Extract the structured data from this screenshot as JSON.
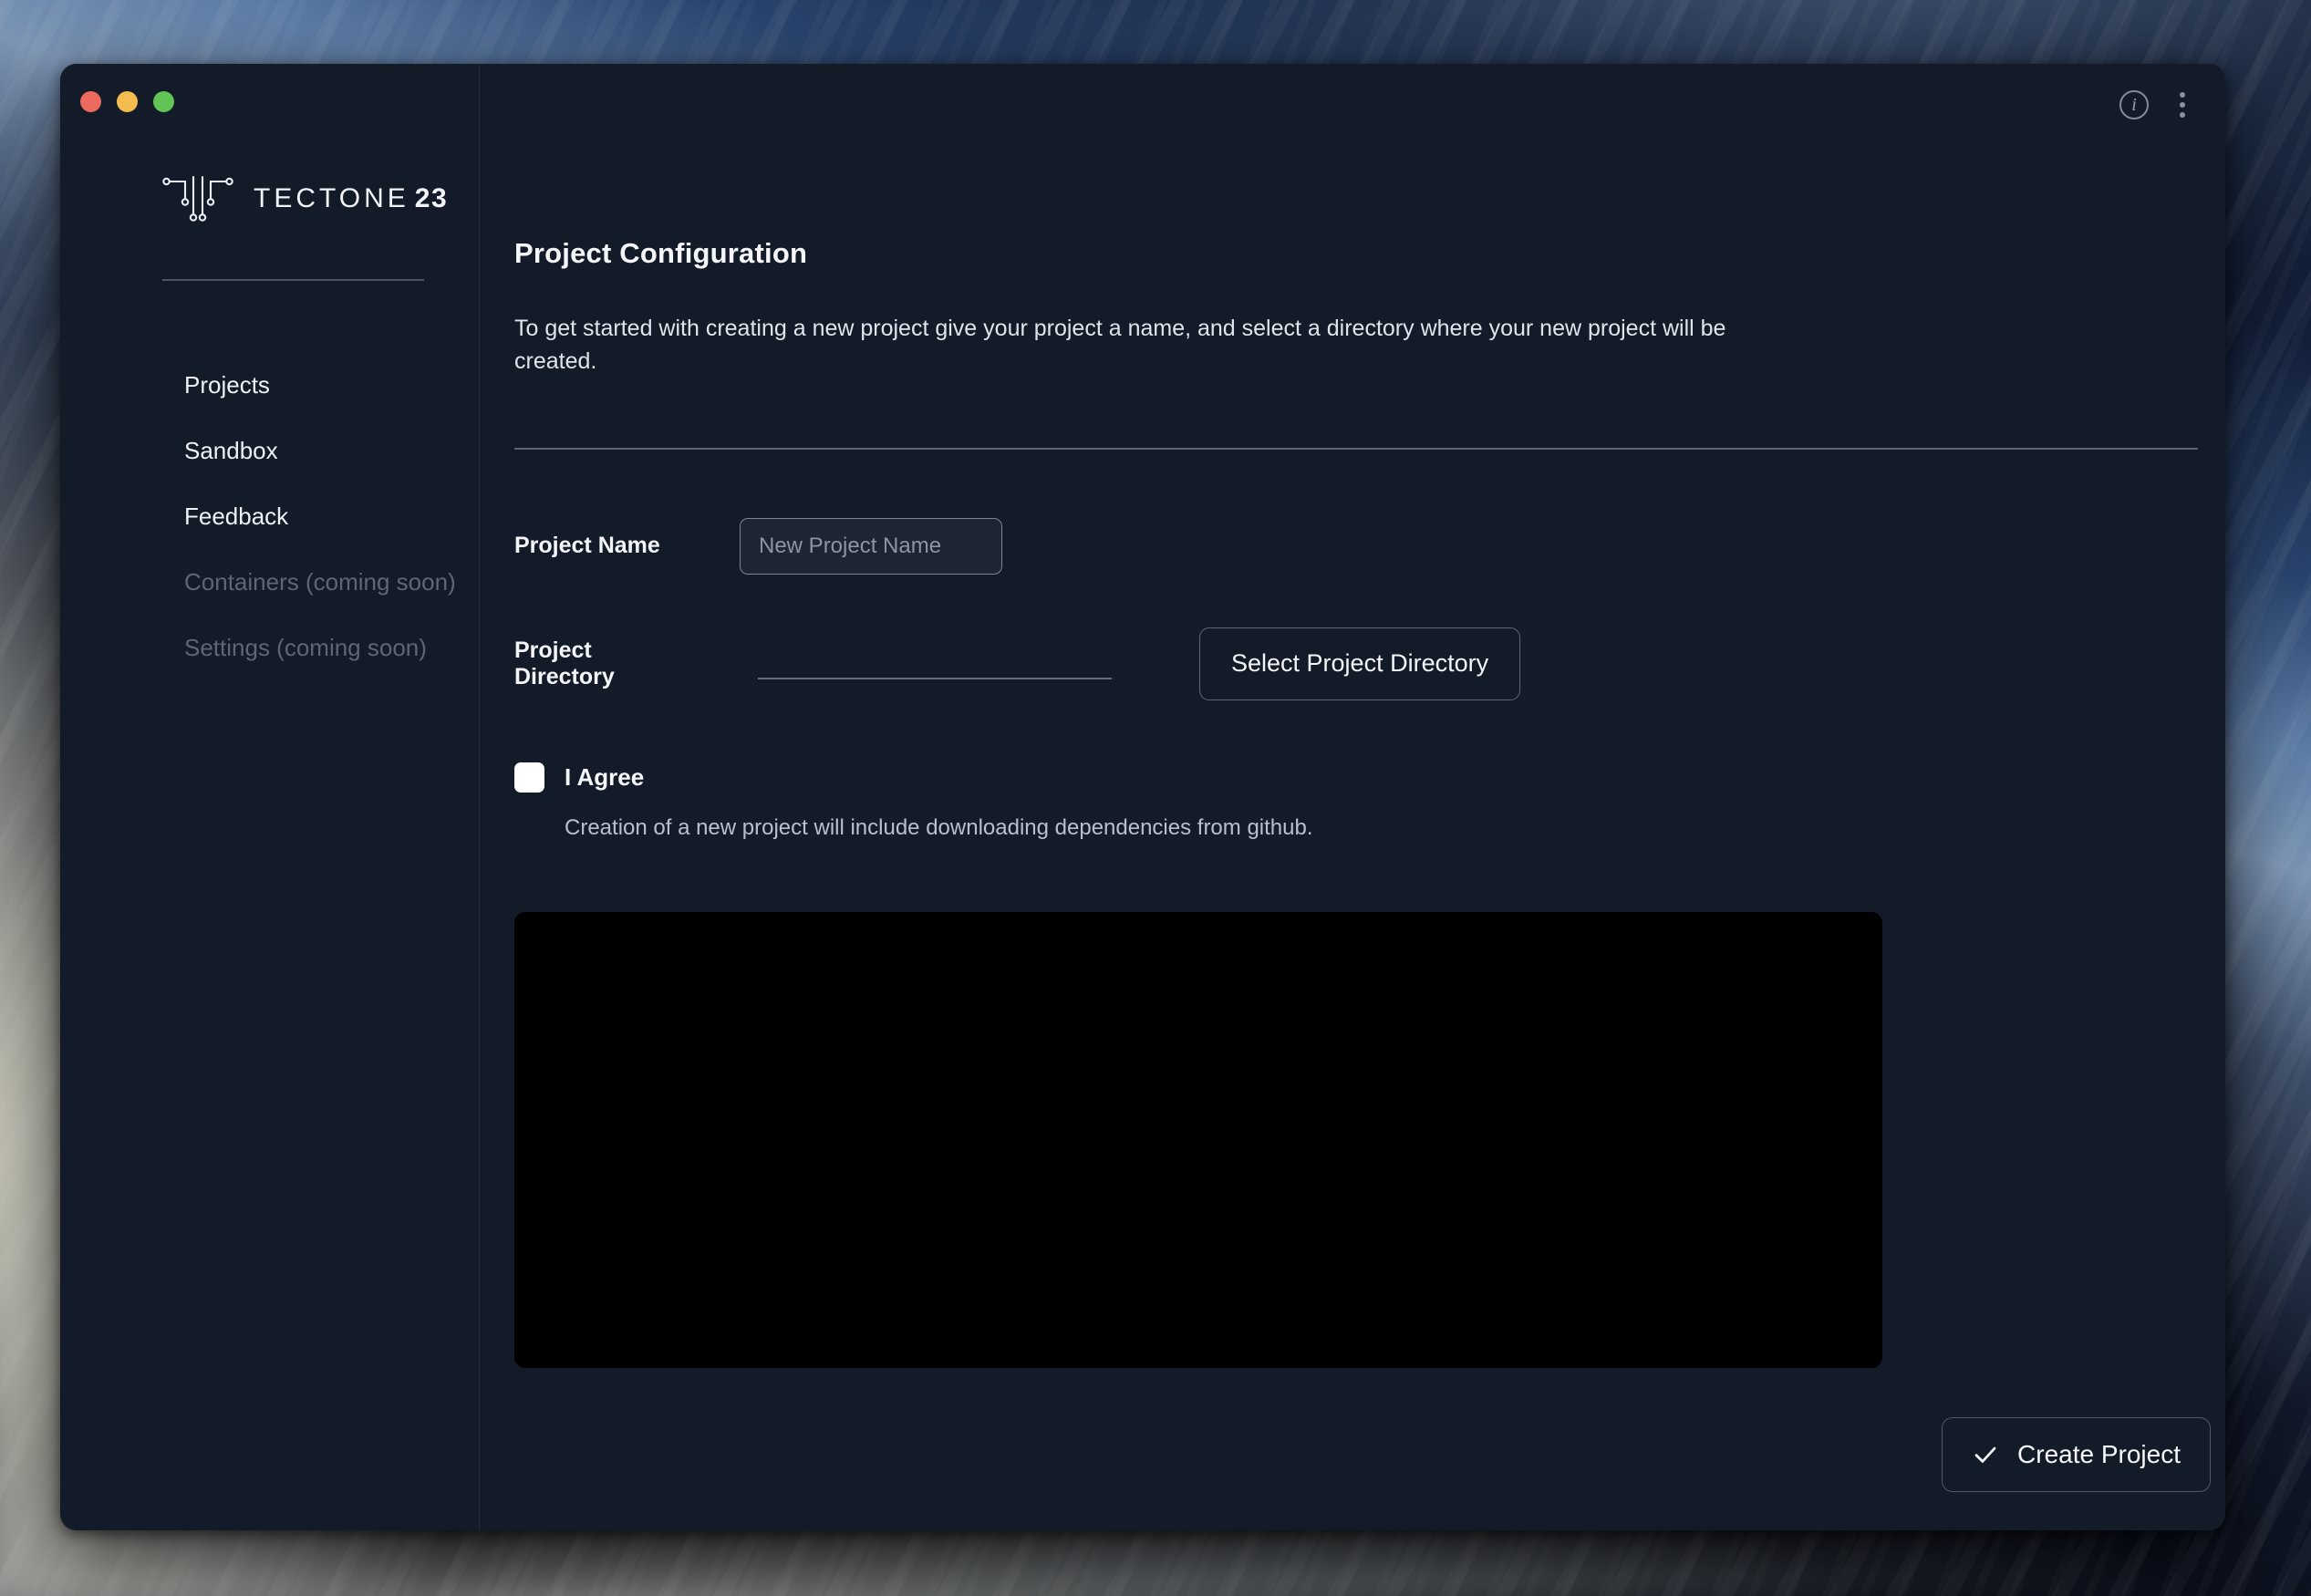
{
  "window": {
    "traffic_lights": [
      {
        "name": "close",
        "color": "#ed6a5e"
      },
      {
        "name": "minimize",
        "color": "#f5bd4f"
      },
      {
        "name": "zoom",
        "color": "#61c454"
      }
    ],
    "info_glyph": "i",
    "menu_icon": "kebab-menu-icon"
  },
  "brand": {
    "name": "TECTONE",
    "number": "23",
    "mark": "circuit-trace-logo"
  },
  "sidebar": {
    "items": [
      {
        "label": "Projects",
        "disabled": false
      },
      {
        "label": "Sandbox",
        "disabled": false
      },
      {
        "label": "Feedback",
        "disabled": false
      },
      {
        "label": "Containers (coming soon)",
        "disabled": true
      },
      {
        "label": "Settings (coming soon)",
        "disabled": true
      }
    ]
  },
  "main": {
    "title": "Project Configuration",
    "description": "To get started with creating a new project give your project a name, and select a directory where your new project will be created.",
    "project_name": {
      "label": "Project Name",
      "value": "",
      "placeholder": "New Project Name"
    },
    "project_directory": {
      "label": "Project Directory",
      "value": "",
      "select_button": "Select Project Directory"
    },
    "agreement": {
      "checkbox_label": "I Agree",
      "checked": false,
      "note": "Creation of a new project will include downloading dependencies from github."
    },
    "output_panel": {
      "content": "",
      "background": "#000000"
    },
    "create_button": {
      "label": "Create Project",
      "icon": "check-icon"
    }
  },
  "colors": {
    "window_background": "#141b28",
    "sidebar_border": "#242c3c",
    "divider": "#5a6478",
    "text_primary": "#f4f6fa",
    "text_secondary": "#dfe4ec",
    "text_disabled": "#5d6679",
    "terminal": "#000000"
  }
}
